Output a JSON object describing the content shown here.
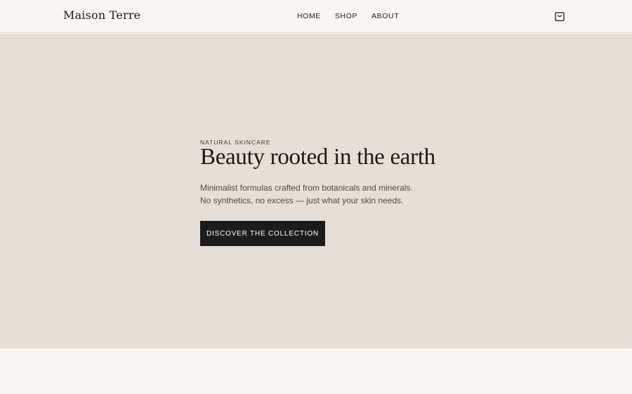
{
  "header": {
    "brand": "Maison Terre",
    "nav": [
      "HOME",
      "SHOP",
      "ABOUT"
    ],
    "cart_icon": "shopping-bag-icon"
  },
  "hero": {
    "eyebrow": "NATURAL SKINCARE",
    "headline": "Beauty rooted in the earth",
    "subcopy": [
      "Minimalist formulas crafted from botanicals and minerals.",
      "No synthetics, no excess — just what your skin needs."
    ],
    "cta_label": "DISCOVER THE COLLECTION"
  },
  "colors": {
    "header_bg": "#f9f6f2",
    "hero_bg": "#e7dfd5",
    "cta_bg": "#1c1c1c",
    "text": "#1a1a1a"
  }
}
